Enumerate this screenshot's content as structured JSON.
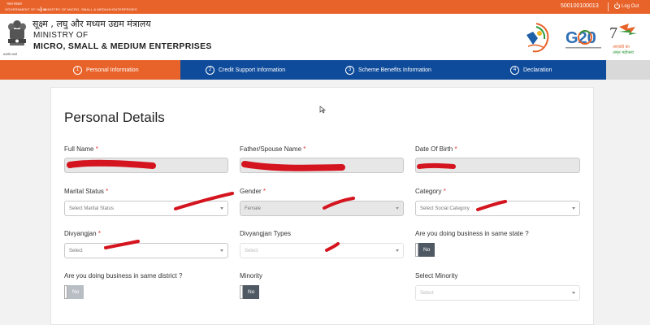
{
  "topbar": {
    "hindi_small": "भारत सरकार",
    "gov": "GOVERNMENT OF INDIA",
    "ministry_small": "MINISTRY OF MICRO, SMALL & MEDIUM ENTERPRISES",
    "user_id": "500100100013",
    "logout_label": "Log Out"
  },
  "header": {
    "hindi_title": "सूक्ष्म , लघु और मध्यम उद्यम मंत्रालय",
    "ministry_of": "MINISTRY OF",
    "msme": "MICRO, SMALL & MEDIUM ENTERPRISES",
    "emblem_caption": "सत्यमेव जयते",
    "g20_text": "G20",
    "amrit_text": "आज़ादी का अमृत महोत्सव"
  },
  "steps": [
    {
      "num": "1",
      "label": "Personal Information"
    },
    {
      "num": "2",
      "label": "Credit Support Information"
    },
    {
      "num": "3",
      "label": "Scheme Benefits Information"
    },
    {
      "num": "4",
      "label": "Declaration"
    }
  ],
  "form": {
    "title": "Personal Details",
    "full_name": {
      "label": "Full Name",
      "required": "*",
      "value": ""
    },
    "father_name": {
      "label": "Father/Spouse Name",
      "required": "*",
      "value": ""
    },
    "dob": {
      "label": "Date Of Birth",
      "required": "*",
      "value": ""
    },
    "marital_status": {
      "label": "Marital Status",
      "required": "*",
      "value": "Select Marital Status"
    },
    "gender": {
      "label": "Gender",
      "required": "*",
      "value": "Female"
    },
    "category": {
      "label": "Category",
      "required": "*",
      "value": "Select Social Category"
    },
    "divyangjan": {
      "label": "Divyangjan",
      "required": "*",
      "value": "Select"
    },
    "divyangjan_types": {
      "label": "Divyangjan Types",
      "value": "Select"
    },
    "same_state": {
      "label": "Are you doing business in same state ?",
      "toggle": "No"
    },
    "same_district": {
      "label": "Are you doing business in same district ?",
      "toggle": "No"
    },
    "minority": {
      "label": "Minority",
      "toggle": "No"
    },
    "select_minority": {
      "label": "Select Minority",
      "value": "Select"
    }
  },
  "colors": {
    "saffron": "#e8632a",
    "navy": "#0f4b9b",
    "redaction": "#d4141e"
  }
}
